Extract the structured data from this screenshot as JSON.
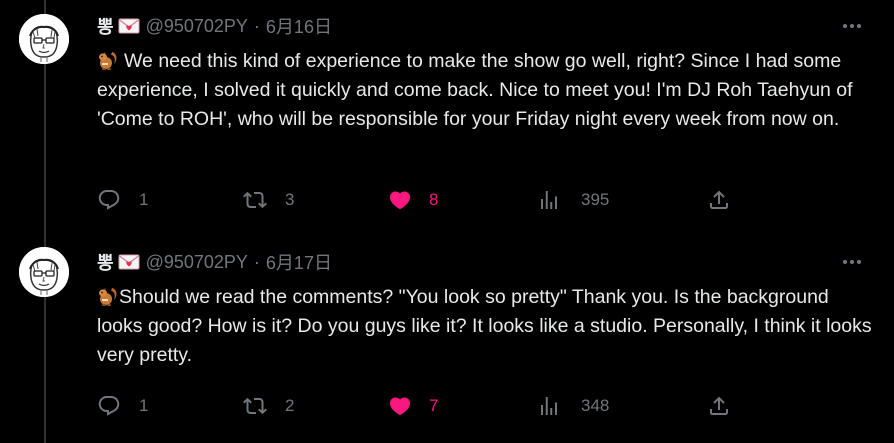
{
  "colors": {
    "background": "#000000",
    "text": "#e7e9ea",
    "muted": "#71767b",
    "like": "#f91880",
    "thread_line": "#2f3336"
  },
  "tweets": [
    {
      "display_name": "뽕",
      "badge_icon": "love-letter-emoji",
      "handle": "@950702PY",
      "separator": "·",
      "date": "6月16日",
      "emoji_icon": "chipmunk-emoji",
      "text": "We need this kind of experience to make the show go well, right? Since I had some experience, I solved it quickly and come back. Nice to meet you! I'm DJ Roh Taehyun of 'Come to ROH', who will be responsible for your Friday night every week from now on.",
      "replies": "1",
      "retweets": "3",
      "likes": "8",
      "views": "395",
      "liked": true
    },
    {
      "display_name": "뽕",
      "badge_icon": "love-letter-emoji",
      "handle": "@950702PY",
      "separator": "·",
      "date": "6月17日",
      "emoji_icon": "chipmunk-emoji",
      "text": "Should we read the comments? \"You look so pretty\" Thank you. Is the background looks good? How is it? Do you guys like it? It looks like a studio. Personally, I think it looks very pretty.",
      "replies": "1",
      "retweets": "2",
      "likes": "7",
      "views": "348",
      "liked": true
    }
  ]
}
